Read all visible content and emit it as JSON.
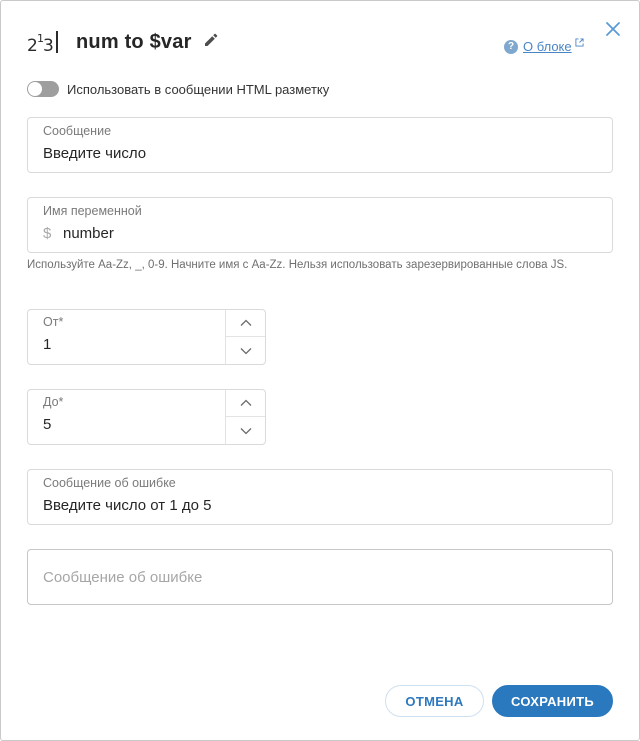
{
  "header": {
    "title": "num to $var",
    "icon": "numbers-block-icon",
    "icon_glyphs": "2¹3",
    "about_label": "О блоке"
  },
  "html_toggle": {
    "label": "Использовать в сообщении HTML разметку",
    "enabled": false
  },
  "message": {
    "label": "Сообщение",
    "value": "Введите число"
  },
  "variable": {
    "label": "Имя переменной",
    "prefix": "$",
    "value": "number",
    "hint": "Используйте Aa-Zz, _, 0-9. Начните имя с Aa-Zz. Нельзя использовать зарезервированные слова JS."
  },
  "from": {
    "label": "От*",
    "value": "1"
  },
  "to": {
    "label": "До*",
    "value": "5"
  },
  "error_message": {
    "label": "Сообщение об ошибке",
    "value": "Введите число от 1 до 5"
  },
  "error_message_empty": {
    "placeholder": "Сообщение об ошибке"
  },
  "buttons": {
    "cancel": "ОТМЕНА",
    "save": "СОХРАНИТЬ"
  },
  "colors": {
    "accent": "#2a78bd",
    "link": "#4a86c5",
    "toggle_off": "#9e9e9e"
  }
}
